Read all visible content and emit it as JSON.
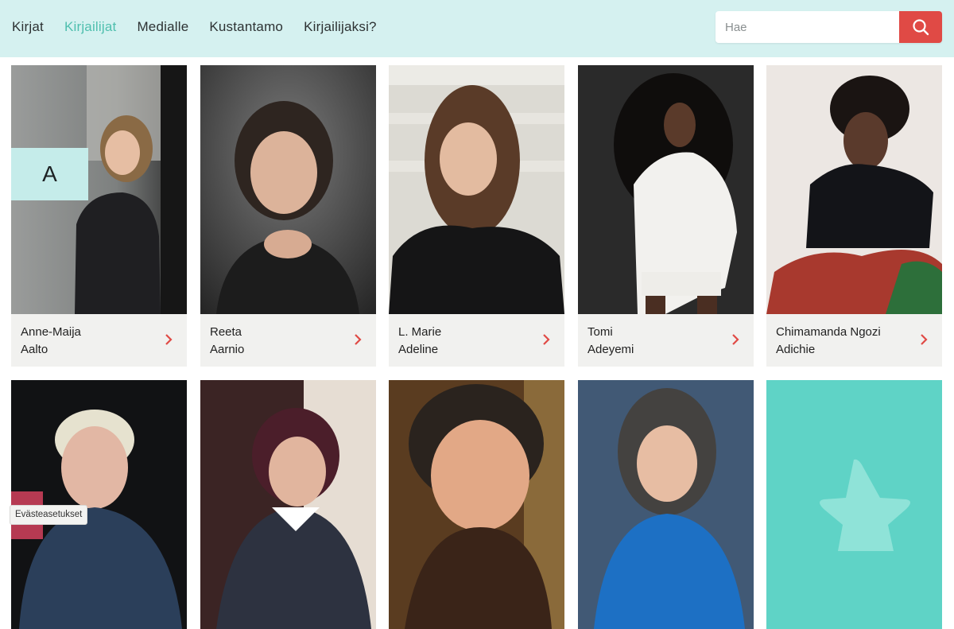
{
  "nav": {
    "items": [
      "Kirjat",
      "Kirjailijat",
      "Medialle",
      "Kustantamo",
      "Kirjailijaksi?"
    ],
    "active_index": 1
  },
  "search": {
    "placeholder": "Hae",
    "icon": "search-icon"
  },
  "section_letter": "A",
  "authors": [
    {
      "first": "Anne-Maija",
      "last": "Aalto"
    },
    {
      "first": "Reeta",
      "last": "Aarnio"
    },
    {
      "first": "L. Marie",
      "last": "Adeline"
    },
    {
      "first": "Tomi",
      "last": "Adeyemi"
    },
    {
      "first": "Chimamanda Ngozi",
      "last": "Adichie"
    }
  ],
  "cookie_button": "Evästeasetukset",
  "colors": {
    "header_bg": "#d5f1f0",
    "active_nav": "#4fbfae",
    "accent_red": "#e04a45",
    "placeholder_card": "#5fd3c6"
  }
}
